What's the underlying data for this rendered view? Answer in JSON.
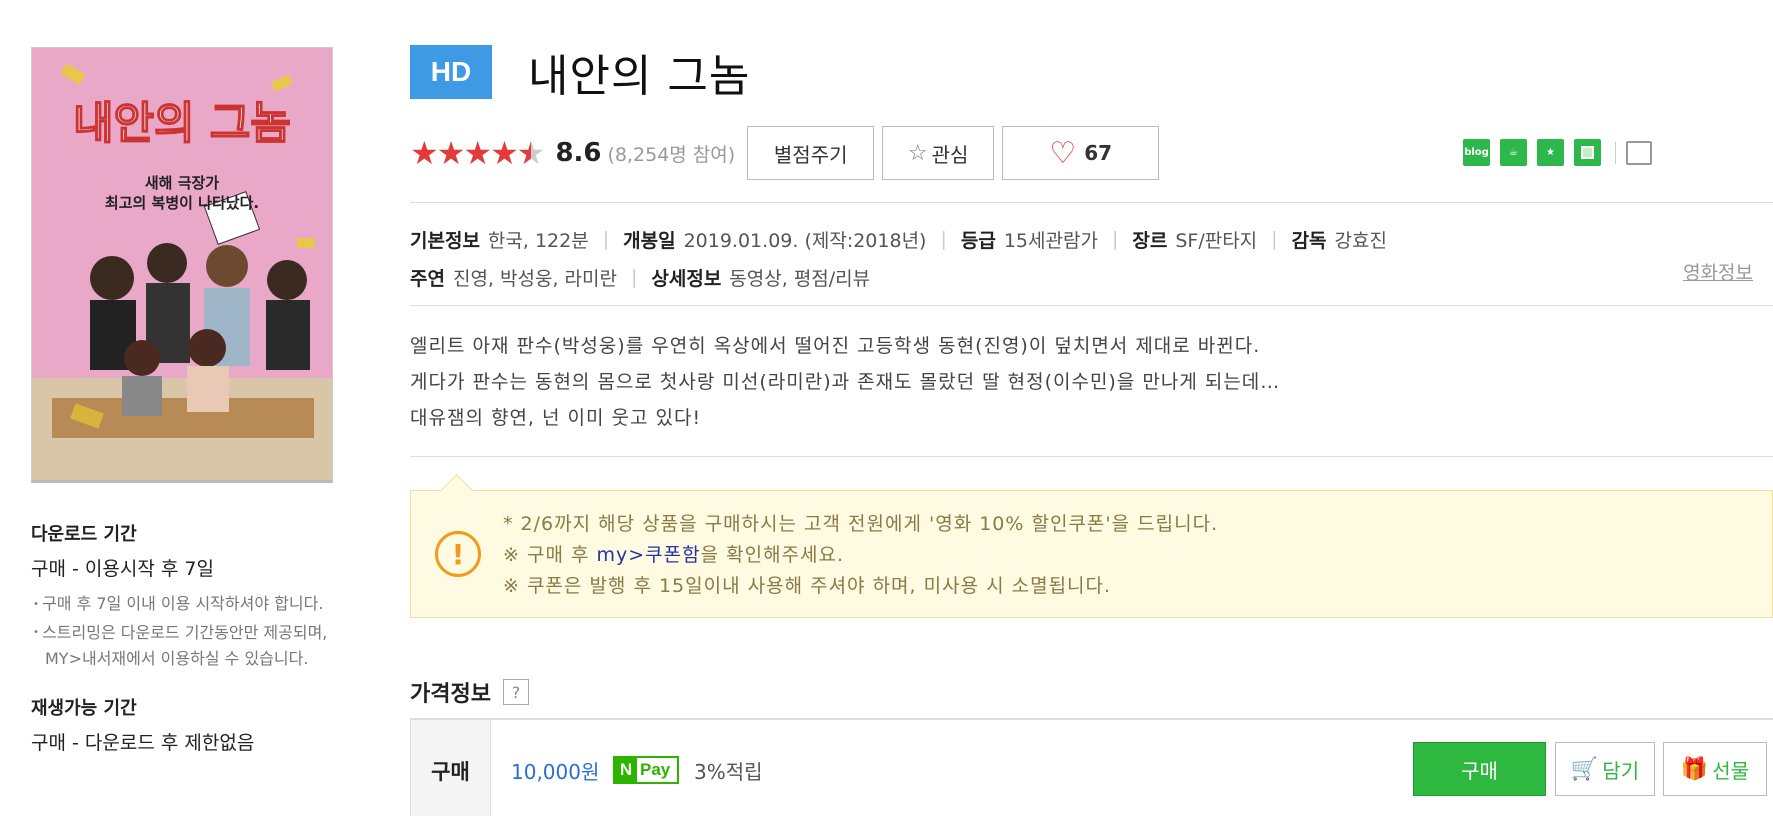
{
  "poster": {
    "title_text": "내안의 그놈",
    "tagline_line1": "새해 극장가",
    "tagline_line2": "최고의 복병이 나타났다."
  },
  "side": {
    "download_title": "다운로드 기간",
    "download_main": "구매 - 이용시작 후 7일",
    "download_notes": [
      "구매 후 7일 이내 이용 시작하셔야 합니다.",
      "스트리밍은 다운로드 기간동안만 제공되며, MY>내서재에서 이용하실 수 있습니다."
    ],
    "replay_title": "재생가능 기간",
    "replay_main": "구매 - 다운로드 후 제한없음"
  },
  "header": {
    "badge": "HD",
    "title": "내안의 그놈"
  },
  "rating": {
    "stars_value": 4.3,
    "score": "8.6",
    "participants": "(8,254명 참여)",
    "rate_button": "별점주기",
    "interest_button": "관심",
    "like_count": "67"
  },
  "share": {
    "icons": [
      "blog-icon",
      "cafe-icon",
      "star-share-icon",
      "line-icon",
      "external-share-icon"
    ]
  },
  "meta": {
    "basic_label": "기본정보",
    "basic_value": "한국, 122분",
    "release_label": "개봉일",
    "release_value": "2019.01.09. (제작:2018년)",
    "grade_label": "등급",
    "grade_value": "15세관람가",
    "genre_label": "장르",
    "genre_value": "SF/판타지",
    "director_label": "감독",
    "director_value": "강효진",
    "cast_label": "주연",
    "cast_value": "진영, 박성웅, 라미란",
    "detail_label": "상세정보",
    "detail_value": "동영상, 평점/리뷰",
    "movie_info_link": "영화정보"
  },
  "synopsis": [
    "엘리트 아재 판수(박성웅)를 우연히 옥상에서 떨어진 고등학생 동현(진영)이 덮치면서 제대로 바뀐다.",
    "게다가 판수는 동현의 몸으로 첫사랑 미선(라미란)과 존재도 몰랐던 딸 현정(이수민)을 만나게 되는데…",
    "대유잼의 향연, 넌 이미 웃고 있다!"
  ],
  "notice": {
    "line1": "* 2/6까지 해당 상품을 구매하시는 고객 전원에게 '영화 10% 할인쿠폰'을 드립니다.",
    "line2_prefix": "※ 구매 후 ",
    "line2_link": "my>쿠폰함",
    "line2_suffix": "을 확인해주세요.",
    "line3": "※ 쿠폰은 발행 후 15일이내 사용해 주셔야 하며, 미사용 시 소멸됩니다."
  },
  "price": {
    "section_title": "가격정보",
    "help": "?",
    "row_label": "구매",
    "amount": "10,000원",
    "npay_n": "N",
    "npay_pay": "Pay",
    "points": "3%적립",
    "buy_button": "구매",
    "cart_button": "담기",
    "gift_button": "선물"
  },
  "colors": {
    "accent_blue": "#3f9ae5",
    "star_red": "#e53a3a",
    "buy_green": "#2eb83f",
    "notice_bg": "#fefbe2",
    "notice_icon": "#f39a1e"
  }
}
